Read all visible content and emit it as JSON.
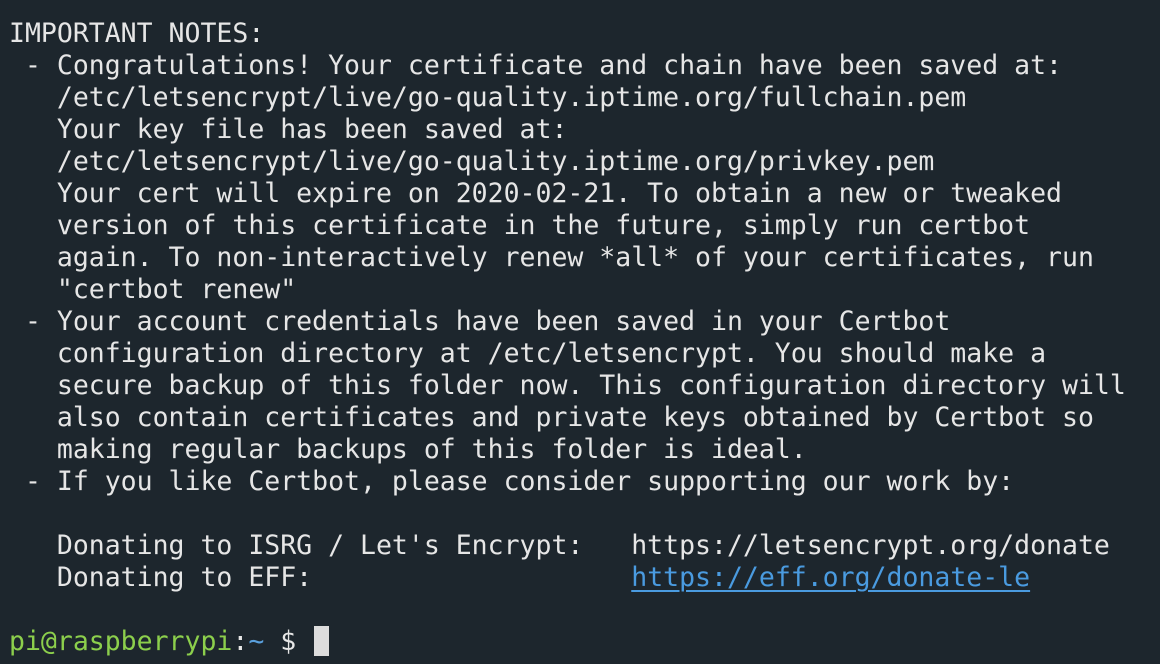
{
  "terminal": {
    "lines": [
      "IMPORTANT NOTES:",
      " - Congratulations! Your certificate and chain have been saved at:",
      "   /etc/letsencrypt/live/go-quality.iptime.org/fullchain.pem",
      "   Your key file has been saved at:",
      "   /etc/letsencrypt/live/go-quality.iptime.org/privkey.pem",
      "   Your cert will expire on 2020-02-21. To obtain a new or tweaked",
      "   version of this certificate in the future, simply run certbot",
      "   again. To non-interactively renew *all* of your certificates, run",
      "   \"certbot renew\"",
      " - Your account credentials have been saved in your Certbot",
      "   configuration directory at /etc/letsencrypt. You should make a",
      "   secure backup of this folder now. This configuration directory will",
      "   also contain certificates and private keys obtained by Certbot so",
      "   making regular backups of this folder is ideal.",
      " - If you like Certbot, please consider supporting our work by:",
      "",
      "   Donating to ISRG / Let's Encrypt:   https://letsencrypt.org/donate"
    ],
    "eff_line_prefix": "   Donating to EFF:                    ",
    "eff_link": "https://eff.org/donate-le",
    "blank_after": "",
    "prompt": {
      "user_host": "pi@raspberrypi",
      "separator": ":",
      "path": "~",
      "symbol": " $ "
    }
  },
  "colors": {
    "background": "#1d262d",
    "text": "#e6e6e6",
    "link": "#4a9be0",
    "prompt_user": "#8ccf4c",
    "prompt_path": "#5aa0dd",
    "cursor": "#dcdcdc"
  }
}
